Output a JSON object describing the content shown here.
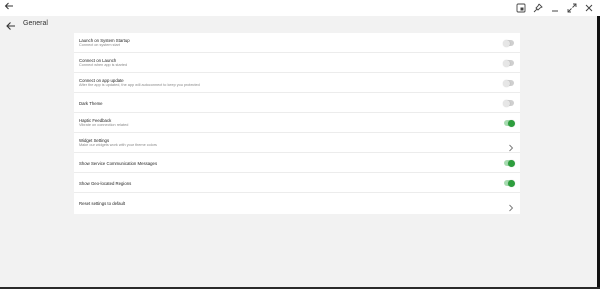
{
  "header": {
    "title": "General"
  },
  "settings": [
    {
      "title": "Launch on System Startup",
      "subtitle": "Connect on system start",
      "control": "toggle",
      "state": "off"
    },
    {
      "title": "Connect on Launch",
      "subtitle": "Connect when app is started",
      "control": "toggle",
      "state": "off"
    },
    {
      "title": "Connect on app update",
      "subtitle": "After the app is updated, the app will autoconnect to keep you protected",
      "control": "toggle",
      "state": "off"
    },
    {
      "title": "Dark Theme",
      "subtitle": "",
      "control": "toggle",
      "state": "off"
    },
    {
      "title": "Haptic Feedback",
      "subtitle": "Vibrate on connection related",
      "control": "toggle",
      "state": "on"
    },
    {
      "title": "Widget Settings",
      "subtitle": "Make our widgets work with your theme colors",
      "control": "chevron",
      "state": ""
    },
    {
      "title": "Show Service Communication Messages",
      "subtitle": "",
      "control": "toggle",
      "state": "on"
    },
    {
      "title": "Show Geo-located Regions",
      "subtitle": "",
      "control": "toggle",
      "state": "on"
    },
    {
      "title": "Reset settings to default",
      "subtitle": "",
      "control": "chevron",
      "state": ""
    }
  ],
  "colors": {
    "toggle_on": "#2e9e3e",
    "toggle_off": "#cfcfcf",
    "panel": "#ffffff",
    "background": "#f2f2f2"
  },
  "icons": {
    "titlebar": [
      "back-arrow-icon"
    ],
    "window": [
      "picture-in-picture-icon",
      "pin-icon",
      "minimize-icon",
      "maximize-icon",
      "close-icon"
    ]
  }
}
